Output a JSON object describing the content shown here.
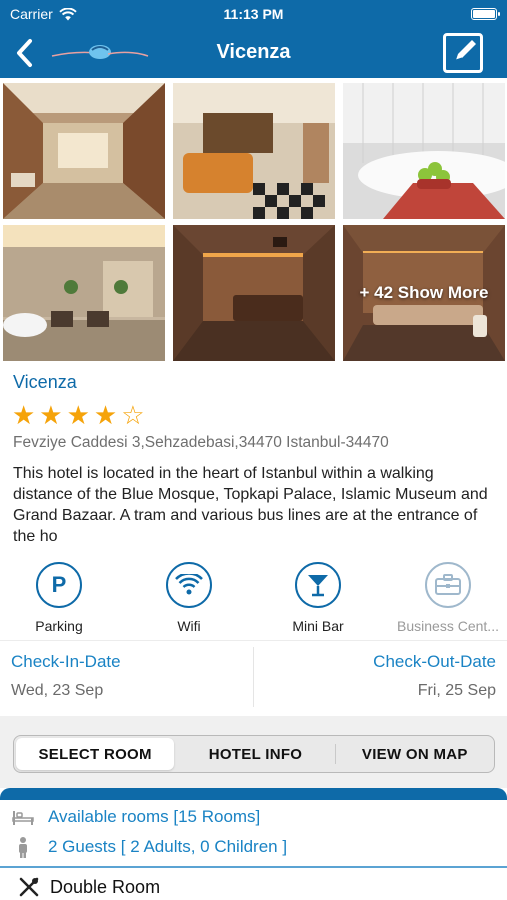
{
  "status": {
    "carrier": "Carrier",
    "time": "11:13 PM"
  },
  "nav": {
    "title": "Vicenza",
    "back_icon": "chevron-left-icon",
    "edit_icon": "edit-icon"
  },
  "gallery": {
    "more_label": "+ 42 Show More"
  },
  "hotel": {
    "name": "Vicenza",
    "stars": "★★★★☆",
    "rating": 4,
    "address": "Fevziye Caddesi 3,Sehzadebasi,34470 Istanbul-34470",
    "description": "This hotel is located in the heart of Istanbul within a walking distance of the Blue Mosque, Topkapi Palace, Islamic Museum and Grand Bazaar. A tram and various bus lines are at the entrance of the ho"
  },
  "amenities": [
    {
      "label": "Parking",
      "icon": "parking-icon"
    },
    {
      "label": "Wifi",
      "icon": "wifi-icon"
    },
    {
      "label": "Mini Bar",
      "icon": "cocktail-icon"
    },
    {
      "label": "Business Cent...",
      "icon": "briefcase-icon"
    }
  ],
  "dates": {
    "check_in_label": "Check-In-Date",
    "check_in_value": "Wed, 23 Sep",
    "check_out_label": "Check-Out-Date",
    "check_out_value": "Fri, 25 Sep"
  },
  "tabs": [
    "SELECT ROOM",
    "HOTEL INFO",
    "VIEW ON MAP"
  ],
  "rooms": {
    "available": "Available rooms [15 Rooms]",
    "guests": "2 Guests [ 2 Adults, 0 Children ]",
    "room_type": "Double Room"
  },
  "colors": {
    "primary": "#0e6aa8",
    "link": "#1a83c4",
    "star": "#f5a30a"
  }
}
